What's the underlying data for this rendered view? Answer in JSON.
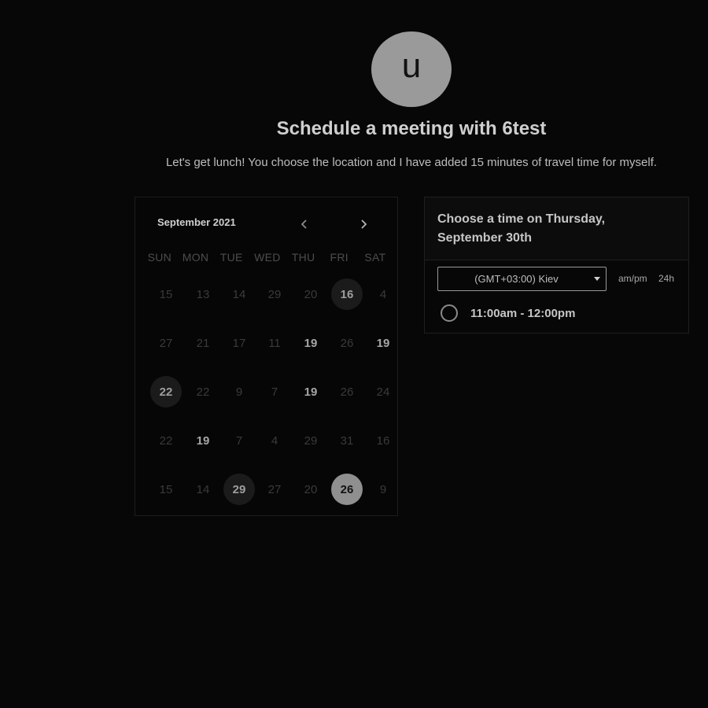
{
  "avatar": {
    "initial": "u"
  },
  "header": {
    "title": "Schedule a meeting with 6test",
    "description": "Let's get lunch! You choose the location and I have added 15 minutes of travel time for myself."
  },
  "calendar": {
    "month_label": "September 2021",
    "prev_icon": "chevron-left-icon",
    "next_icon": "chevron-right-icon",
    "weekdays": [
      "SUN",
      "MON",
      "TUE",
      "WED",
      "THU",
      "FRI",
      "SAT"
    ],
    "weeks": [
      [
        "15",
        "13",
        "14",
        "29",
        "20",
        "16",
        "4"
      ],
      [
        "27",
        "21",
        "17",
        "11",
        "19",
        "26",
        "19"
      ],
      [
        "22",
        "22",
        "9",
        "7",
        "19",
        "26",
        "24"
      ],
      [
        "22",
        "19",
        "7",
        "4",
        "29",
        "31",
        "16"
      ],
      [
        "15",
        "14",
        "29",
        "27",
        "20",
        "26",
        "9"
      ]
    ],
    "states": [
      [
        "",
        "",
        "",
        "",
        "",
        "hl",
        ""
      ],
      [
        "",
        "",
        "",
        "",
        "bold",
        "",
        "bold"
      ],
      [
        "hl",
        "",
        "",
        "",
        "bold",
        "",
        ""
      ],
      [
        "",
        "bold",
        "",
        "",
        "",
        "",
        ""
      ],
      [
        "",
        "",
        "hl",
        "",
        "",
        "sel",
        ""
      ]
    ]
  },
  "time_panel": {
    "title": "Choose a time on Thursday, September 30th",
    "timezone": "(GMT+03:00) Kiev",
    "caret_icon": "caret-down-icon",
    "format_ampm": "am/pm",
    "format_24h": "24h",
    "slots": [
      {
        "label": "11:00am - 12:00pm"
      }
    ]
  },
  "colors": {
    "background": "#070707",
    "selected_day": "#8f8f8f",
    "highlight_day": "#1b1b1b"
  }
}
